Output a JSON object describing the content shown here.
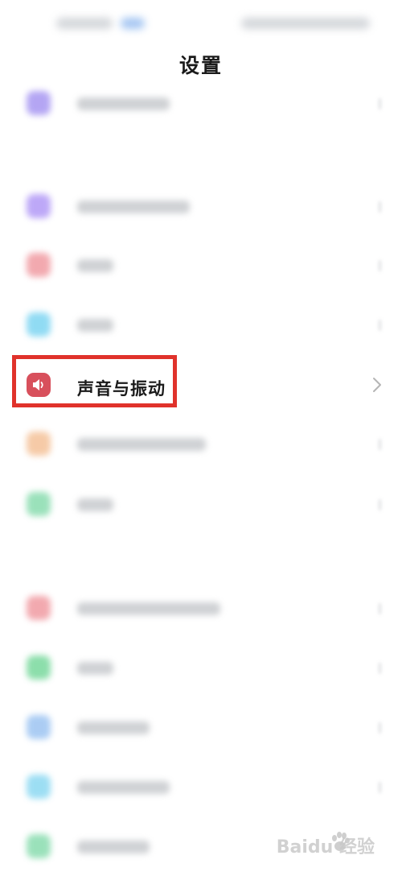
{
  "header": {
    "title": "设置"
  },
  "settings": {
    "rows": [
      {
        "name": "row-0",
        "icon_color": "#9b88f0"
      },
      {
        "name": "row-1",
        "icon_color": "#a78bf5"
      },
      {
        "name": "row-2",
        "icon_color": "#ee8d95"
      },
      {
        "name": "row-3",
        "icon_color": "#6ccff0"
      },
      {
        "name": "sound-vibration",
        "label": "声音与振动",
        "icon": "speaker-icon",
        "icon_color": "#d8505c"
      },
      {
        "name": "row-5",
        "icon_color": "#f3b98a"
      },
      {
        "name": "row-6",
        "icon_color": "#79d7a4"
      },
      {
        "name": "row-7",
        "icon_color": "#ee8d95"
      },
      {
        "name": "row-8",
        "icon_color": "#66d38f"
      },
      {
        "name": "row-9",
        "icon_color": "#8fbcf0"
      },
      {
        "name": "row-10",
        "icon_color": "#7cd3f0"
      },
      {
        "name": "row-11",
        "icon_color": "#79d7a4"
      }
    ]
  },
  "highlight": {
    "color": "#e0322b"
  },
  "watermark": {
    "text": "Baidu 经验"
  }
}
